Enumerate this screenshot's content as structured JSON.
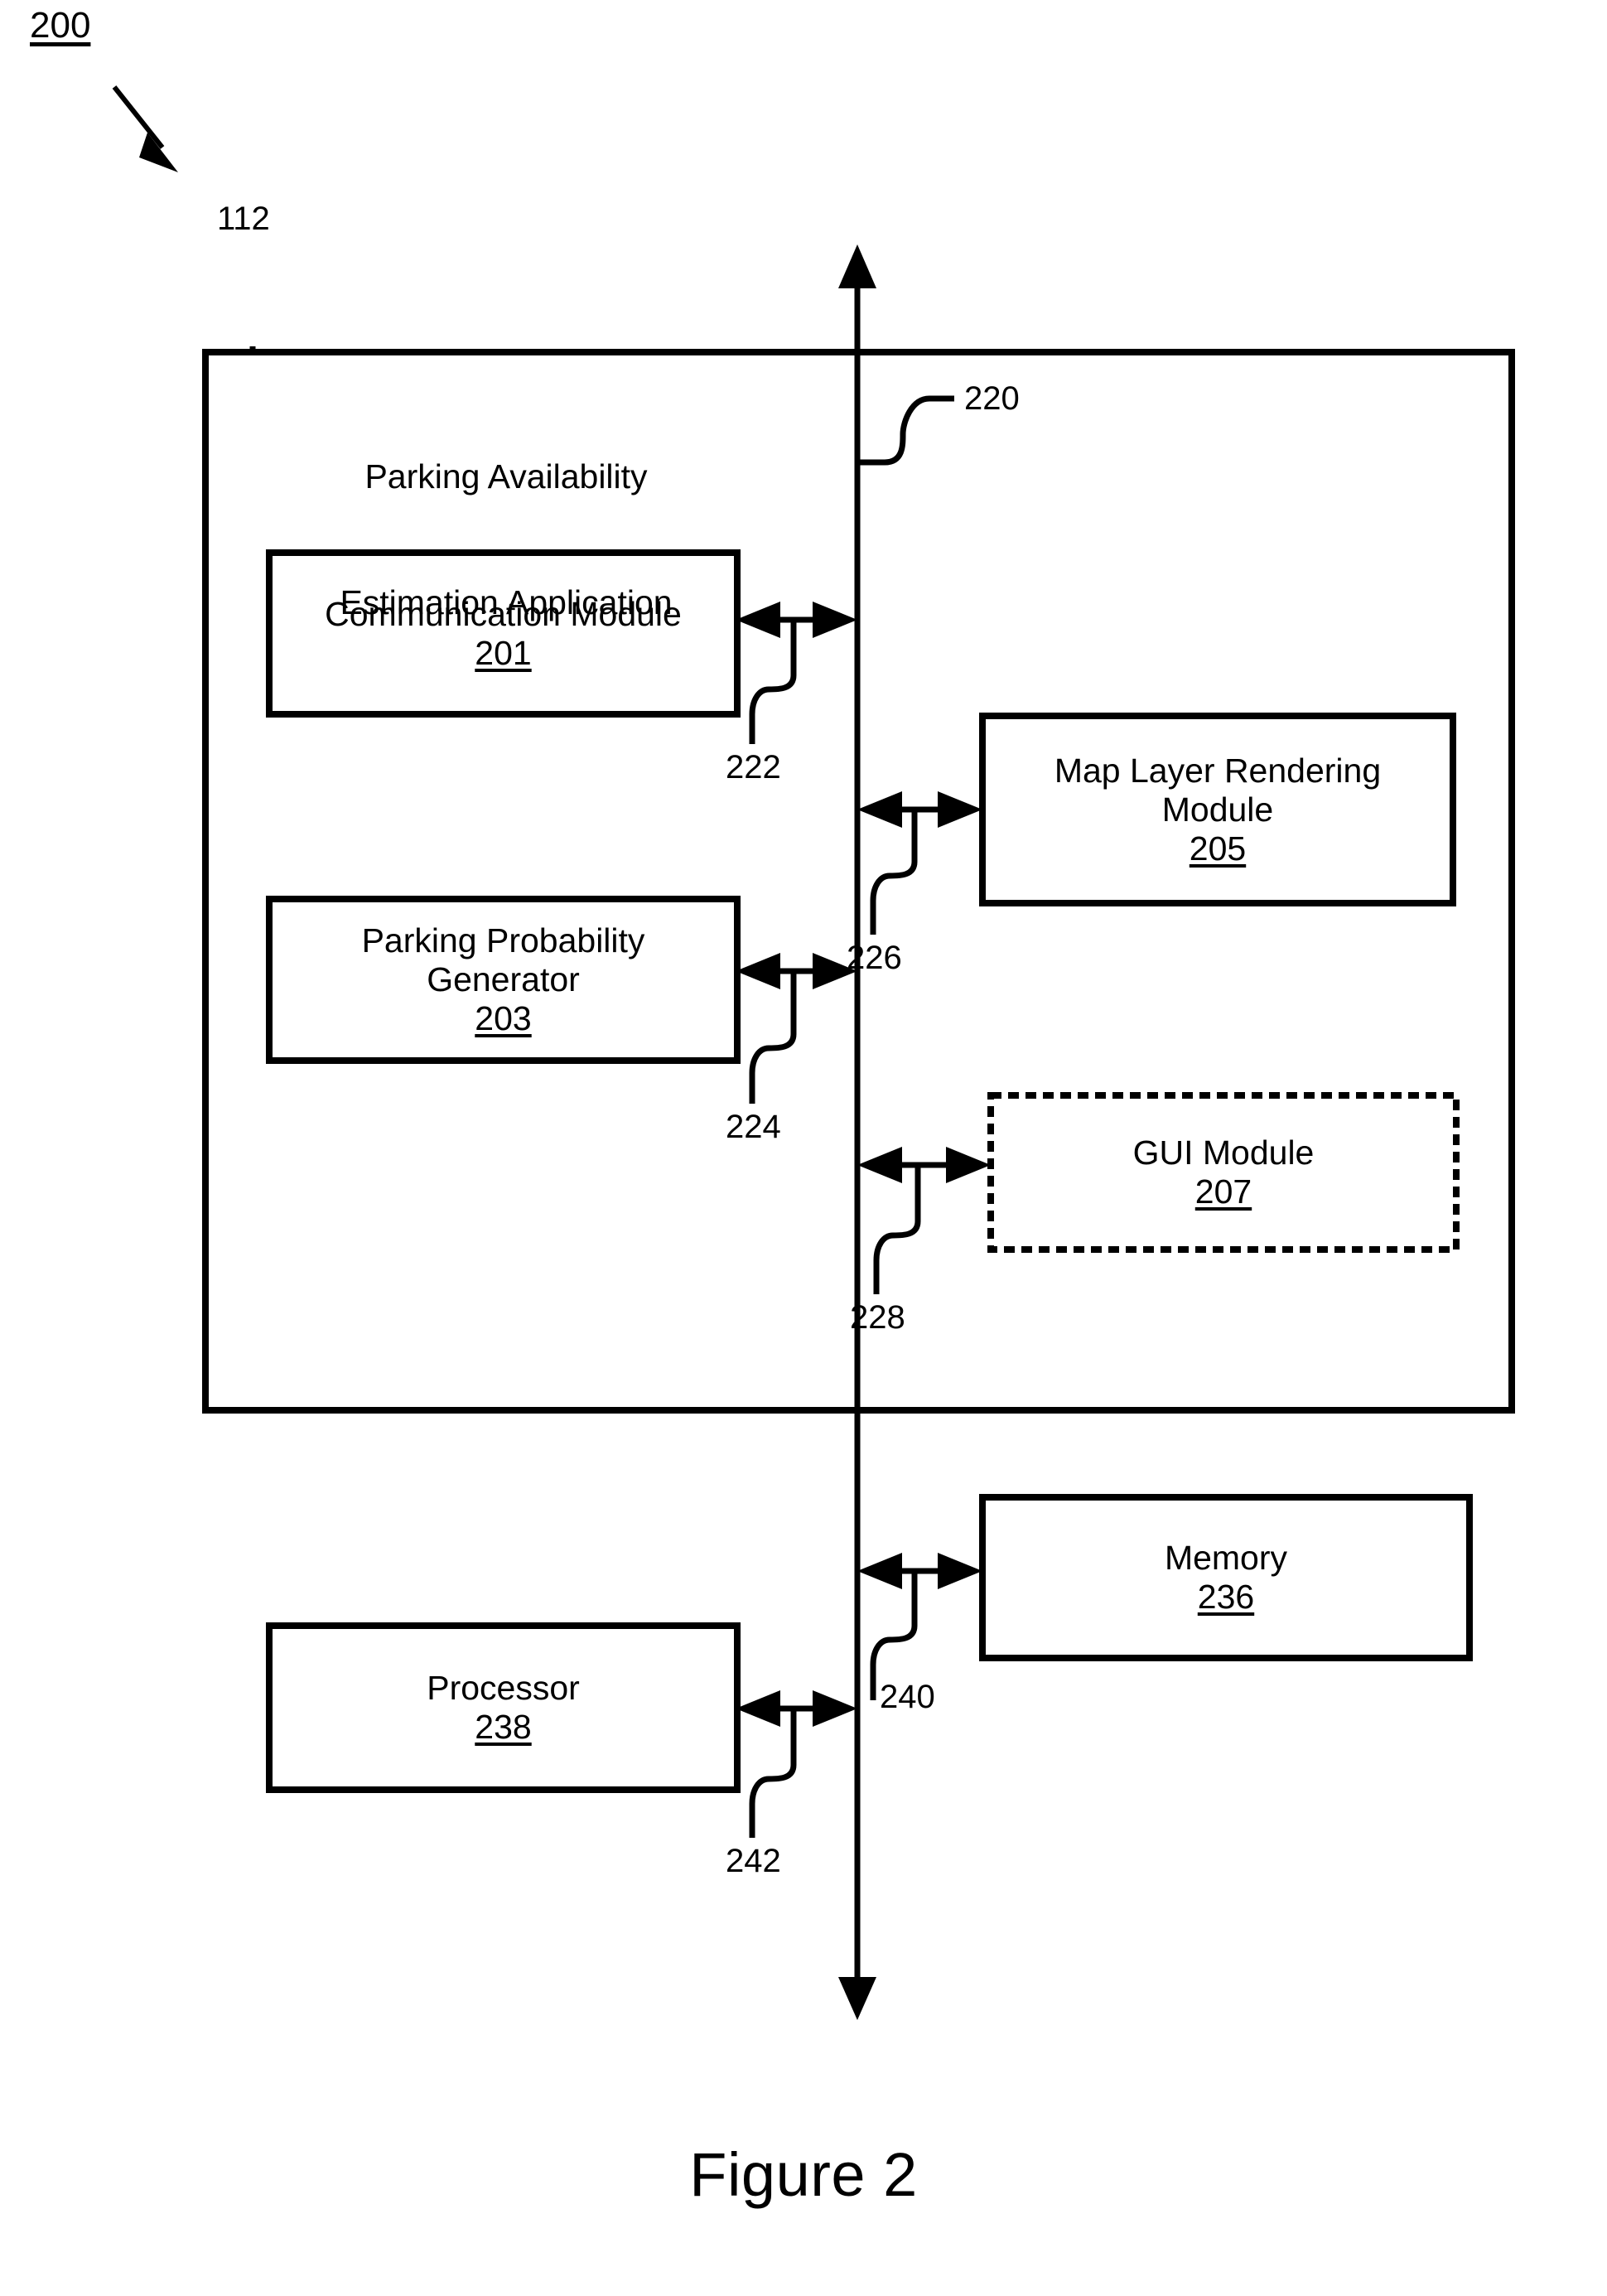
{
  "figure": {
    "sheet_ref": "200",
    "caption": "Figure 2"
  },
  "diagram": {
    "outer_box": {
      "ref": "112",
      "title_line1": "Parking Availability",
      "title_line2": "Estimation Application"
    },
    "bus": {
      "ref": "220",
      "name": "bus-line"
    },
    "modules": [
      {
        "id": "communication-module",
        "label_line1": "Communication Module",
        "label_line2": "",
        "ref": "201",
        "connector_ref": "222",
        "border": "solid"
      },
      {
        "id": "parking-probability-generator",
        "label_line1": "Parking Probability",
        "label_line2": "Generator",
        "ref": "203",
        "connector_ref": "224",
        "border": "solid"
      },
      {
        "id": "map-layer-rendering-module",
        "label_line1": "Map Layer Rendering",
        "label_line2": "Module",
        "ref": "205",
        "connector_ref": "226",
        "border": "solid"
      },
      {
        "id": "gui-module",
        "label_line1": "GUI Module",
        "label_line2": "",
        "ref": "207",
        "connector_ref": "228",
        "border": "dashed"
      },
      {
        "id": "memory",
        "label_line1": "Memory",
        "label_line2": "",
        "ref": "236",
        "connector_ref": "240",
        "border": "solid"
      },
      {
        "id": "processor",
        "label_line1": "Processor",
        "label_line2": "",
        "ref": "238",
        "connector_ref": "242",
        "border": "solid"
      }
    ],
    "colors": {
      "line": "#000000",
      "background": "#ffffff",
      "text": "#000000"
    }
  }
}
